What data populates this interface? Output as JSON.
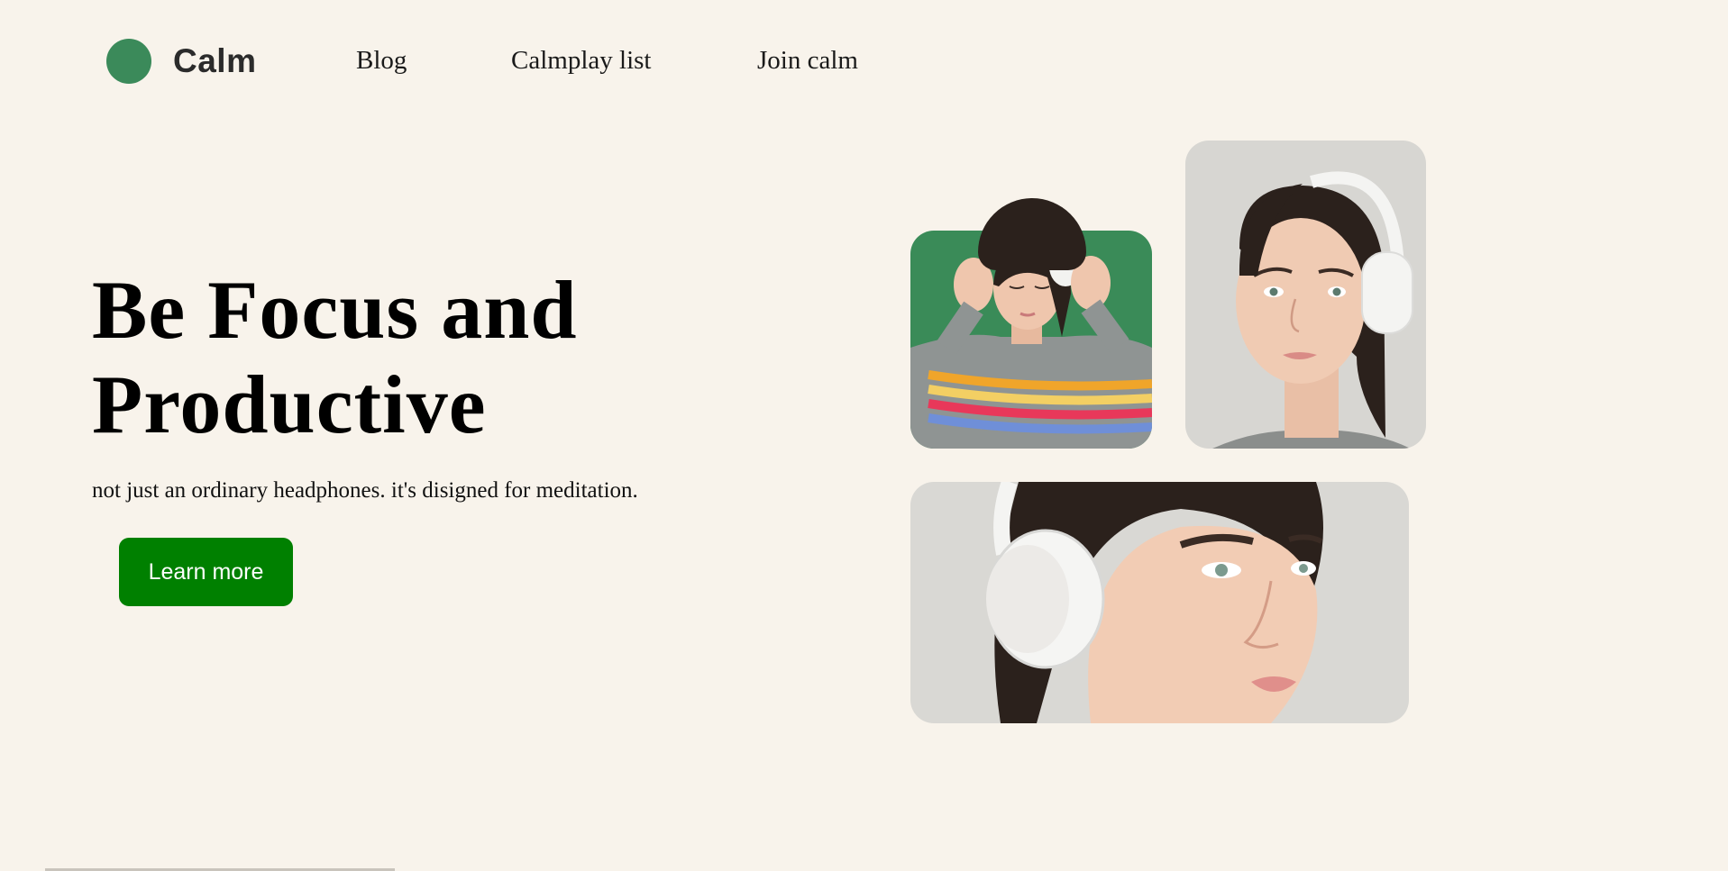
{
  "brand": {
    "name": "Calm",
    "accent_color": "#3b8a5a"
  },
  "nav": {
    "items": [
      {
        "label": "Blog"
      },
      {
        "label": "Calmplay list"
      },
      {
        "label": "Join calm"
      }
    ]
  },
  "hero": {
    "title_line1": "Be Focus and",
    "title_line2": "Productive",
    "subtitle": "not just an ordinary headphones. it's disigned for meditation.",
    "cta_label": "Learn more",
    "cta_color": "#008000"
  },
  "gallery": {
    "photos": [
      {
        "subject": "woman-headphones-eyes-closed",
        "background": "#3a8b58"
      },
      {
        "subject": "woman-headphones-profile",
        "background": "#d7d6d2"
      },
      {
        "subject": "woman-headphones-closeup",
        "background": "#d9d8d4"
      }
    ]
  },
  "colors": {
    "page_background": "#f8f3eb",
    "text": "#000000"
  }
}
